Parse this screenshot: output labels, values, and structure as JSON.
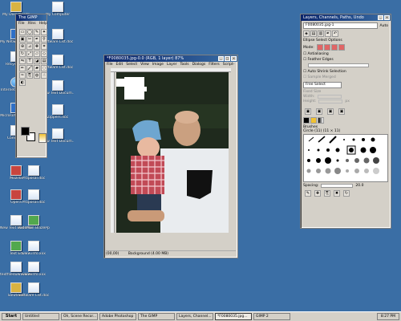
{
  "desktop": {
    "icons": [
      {
        "label": "My Documents",
        "icon": "folder-icon"
      },
      {
        "label": "My Network Places",
        "icon": "network-icon"
      },
      {
        "label": "Recycle Bin",
        "icon": "recycle-bin-icon"
      },
      {
        "label": "Internet Explorer",
        "icon": "globe-icon"
      },
      {
        "label": "Microsoft Outlook",
        "icon": "mail-icon"
      },
      {
        "label": "Computer",
        "icon": "computer-icon"
      },
      {
        "label": "Mozilla",
        "icon": "browser-icon"
      },
      {
        "label": "Opera",
        "icon": "browser-icon"
      },
      {
        "label": "New Text Document.txt",
        "icon": "text-document-icon"
      },
      {
        "label": "Text Ed",
        "icon": "text-editor-icon"
      },
      {
        "label": "textfileswww Energy Tec...",
        "icon": "text-document-icon"
      },
      {
        "label": "Solutions",
        "icon": "folder-icon"
      },
      {
        "label": "Proposal.doc",
        "icon": "word-document-icon"
      },
      {
        "label": "Proposal.doc",
        "icon": "word-document-icon"
      },
      {
        "label": "PadeMan BlazePp",
        "icon": "application-icon"
      },
      {
        "label": "www.info.xxx",
        "icon": "text-document-icon"
      },
      {
        "label": "www.info.xxx",
        "icon": "text-document-icon"
      },
      {
        "label": "Software List.doc",
        "icon": "word-document-icon"
      },
      {
        "label": "My Computer",
        "icon": "computer-icon"
      },
      {
        "label": "Software List.doc",
        "icon": "word-document-icon"
      },
      {
        "label": "Software List.doc",
        "icon": "word-document-icon"
      },
      {
        "label": "New Text Docum...",
        "icon": "text-document-icon"
      },
      {
        "label": "Zippers.doc",
        "icon": "word-document-icon"
      },
      {
        "label": "New Text Docum...",
        "icon": "text-document-icon"
      }
    ]
  },
  "toolbox": {
    "title": "The GIMP",
    "menus": [
      "File",
      "Xtns",
      "Help"
    ],
    "fg_color": "#000000",
    "bg_color": "#ffffff"
  },
  "image_window": {
    "title": "*F0080035.jpg-0.0 (RGB, 1 layer) 87%",
    "menus": [
      "File",
      "Edit",
      "Select",
      "View",
      "Image",
      "Layer",
      "Tools",
      "Dialogs",
      "Filters",
      "Script-Fu"
    ],
    "status_zoom": "(00,00)",
    "status_text": "Background (4.00 MB)"
  },
  "dock": {
    "title": "Layers, Channels, Paths, Undo",
    "image_selector": "F0080035.jpg-1",
    "auto_label": "Auto",
    "options_title": "Ellipse Select Options",
    "mode_label": "Mode:",
    "antialiasing": "Antialiasing",
    "feather_label": "Feather Edges",
    "auto_shrink": "Auto Shrink Selection",
    "sample_merged": "Sample Merged",
    "free_select": "Free Select",
    "fixed_size": "Fixed Size",
    "width_label": "Width:",
    "height_label": "Height:",
    "unit": "px",
    "brushes_title": "Brushes",
    "brush_name": "Circle (11) (11 × 11)",
    "spacing_label": "Spacing:",
    "spacing_value": "20.0"
  },
  "taskbar": {
    "start": "Start",
    "tasks": [
      "Untitled",
      "Oh, Scene Recor...",
      "Adobe Photoshop",
      "The GIMP",
      "Layers, Channel...",
      "*F0080035.jpg...",
      "GIMP 2"
    ],
    "time": "8:27 PM"
  }
}
